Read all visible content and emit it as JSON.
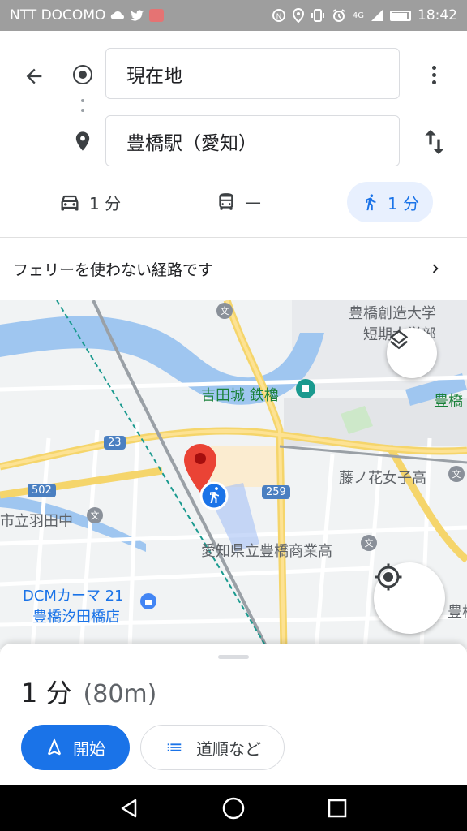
{
  "status_bar": {
    "carrier": "NTT DOCOMO",
    "time": "18:42",
    "network": "4G"
  },
  "directions": {
    "origin": "現在地",
    "destination": "豊橋駅（愛知）",
    "modes": {
      "car": "1 分",
      "transit": "—",
      "walk": "1 分"
    },
    "notice": "フェリーを使わない経路です"
  },
  "map": {
    "labels": {
      "university": "豊橋創造大学",
      "university2": "短期大学部",
      "castle": "吉田城 鉄櫓",
      "toyohashi_right": "豊橋",
      "girls_high": "藤ノ花女子高",
      "school_left": "市立羽田中",
      "commercial_high": "愛知県立豊橋商業高",
      "dcm1": "DCMカーマ 21",
      "dcm2": "豊橋汐田橋店",
      "toyohashi_right2": "豊橋"
    },
    "shields": {
      "r23": "23",
      "r502": "502",
      "r259": "259"
    }
  },
  "sheet": {
    "duration": "1 分",
    "distance": "(80m)",
    "start_label": "開始",
    "steps_label": "道順など"
  },
  "colors": {
    "accent": "#1a73e8",
    "pin": "#ea4335",
    "status_bar": "#9e9e9e"
  }
}
